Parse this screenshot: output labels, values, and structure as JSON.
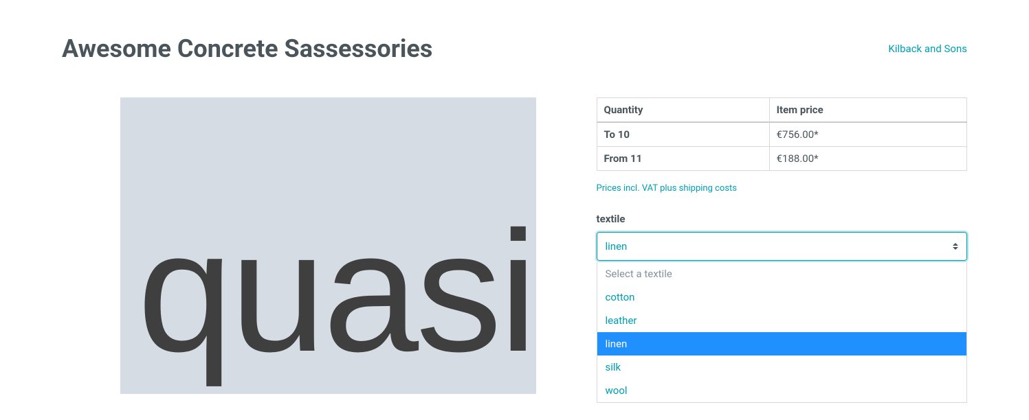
{
  "header": {
    "title": "Awesome Concrete Sassessories",
    "brand": "Kilback and Sons"
  },
  "image": {
    "placeholder_text": "quasi"
  },
  "pricing": {
    "headers": {
      "quantity": "Quantity",
      "price": "Item price"
    },
    "rows": [
      {
        "qty": "To 10",
        "price": "€756.00*"
      },
      {
        "qty": "From 11",
        "price": "€188.00*"
      }
    ],
    "tax_note": "Prices incl. VAT plus shipping costs"
  },
  "variant": {
    "label": "textile",
    "selected": "linen",
    "placeholder": "Select a textile",
    "options": [
      "cotton",
      "leather",
      "linen",
      "silk",
      "wool"
    ]
  }
}
